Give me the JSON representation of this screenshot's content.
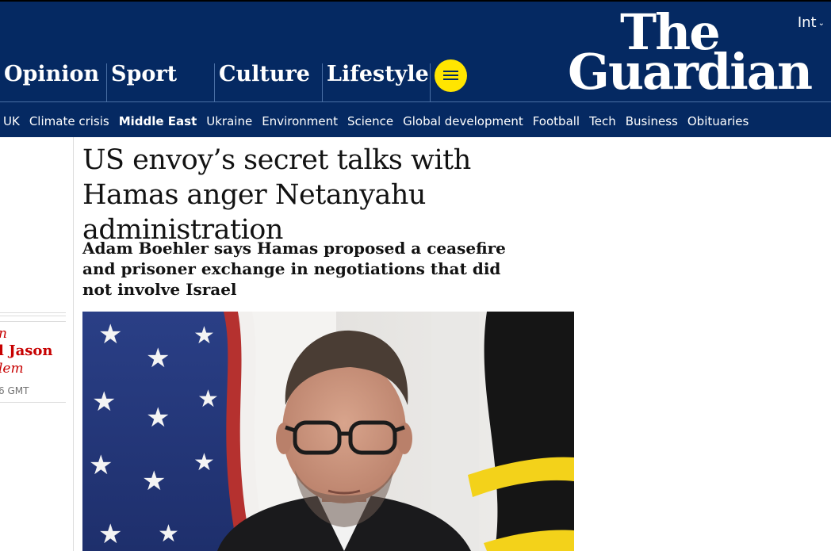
{
  "header": {
    "edition": "Int",
    "logo": {
      "line1": "The",
      "line2": "Guardian"
    },
    "pillars": [
      "Opinion",
      "Sport",
      "Culture",
      "Lifestyle"
    ],
    "menu_icon": "hamburger-icon",
    "subnav": [
      "UK",
      "Climate crisis",
      "Middle East",
      "Ukraine",
      "Environment",
      "Science",
      "Global development",
      "Football",
      "Tech",
      "Business",
      "Obituaries"
    ],
    "active_subnav": "Middle East"
  },
  "article": {
    "headline": "US envoy’s secret talks with Hamas anger Netanyahu administration",
    "standfirst": "Adam Boehler says Hamas proposed a ceasefire and prisoner exchange in negotiations that did not involve Israel",
    "byline": {
      "line1": "n",
      "line2": "l Jason",
      "line3": "lem"
    },
    "dateline": "6 GMT"
  },
  "colors": {
    "brand_blue": "#052962",
    "menu_yellow": "#ffe500",
    "byline_red": "#c70000"
  }
}
